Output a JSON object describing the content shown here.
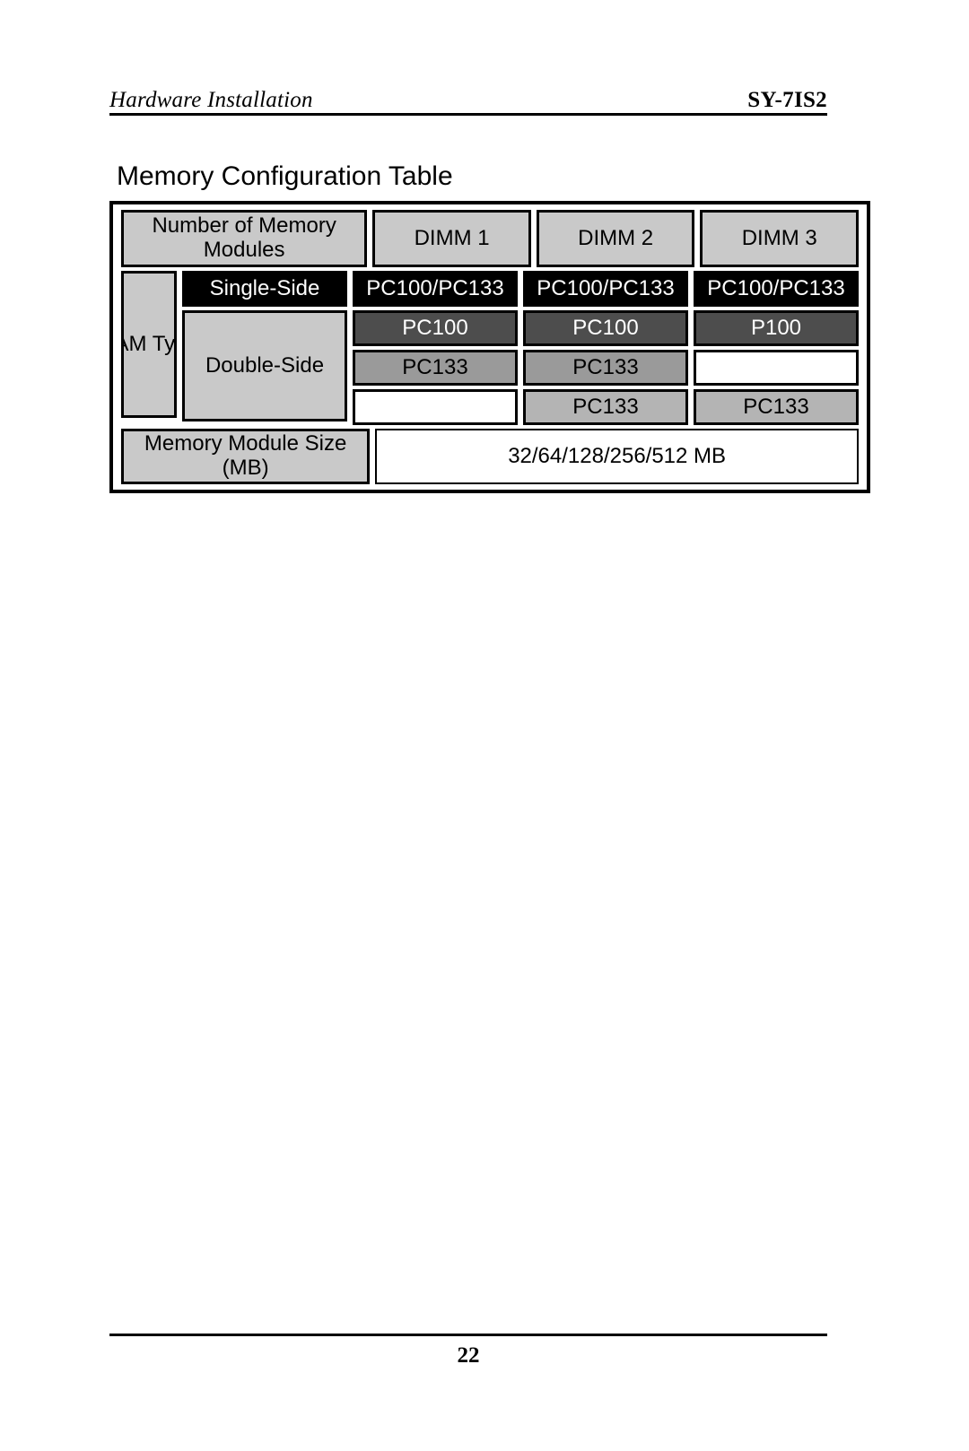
{
  "header": {
    "left_title": "Hardware Installation",
    "right_title": "SY-7IS2"
  },
  "section": {
    "title": "Memory Configuration Table"
  },
  "table": {
    "header_row": {
      "label": "Number of Memory Modules",
      "dimm1": "DIMM 1",
      "dimm2": "DIMM 2",
      "dimm3": "DIMM 3"
    },
    "ram_type_label": "RAM Type",
    "single_side": {
      "label": "Single-Side",
      "dimm1": "PC100/PC133",
      "dimm2": "PC100/PC133",
      "dimm3": "PC100/PC133"
    },
    "double_side": {
      "label": "Double-Side",
      "row1": {
        "dimm1": "PC100",
        "dimm2": "PC100",
        "dimm3": "P100"
      },
      "row2": {
        "dimm1": "PC133",
        "dimm2": "PC133",
        "dimm3": ""
      },
      "row3": {
        "dimm1": "",
        "dimm2": "PC133",
        "dimm3": "PC133"
      }
    },
    "module_size": {
      "label": "Memory Module Size (MB)",
      "value": "32/64/128/256/512 MB"
    }
  },
  "footer": {
    "page_number": "22"
  },
  "colors": {
    "header_gray": "#c9c9c9",
    "black_cell": "#000000",
    "dark_gray": "#4d4d4d",
    "mid_gray": "#9a9a9a",
    "light_gray": "#b4b4b4",
    "white_cell": "#ffffff"
  }
}
